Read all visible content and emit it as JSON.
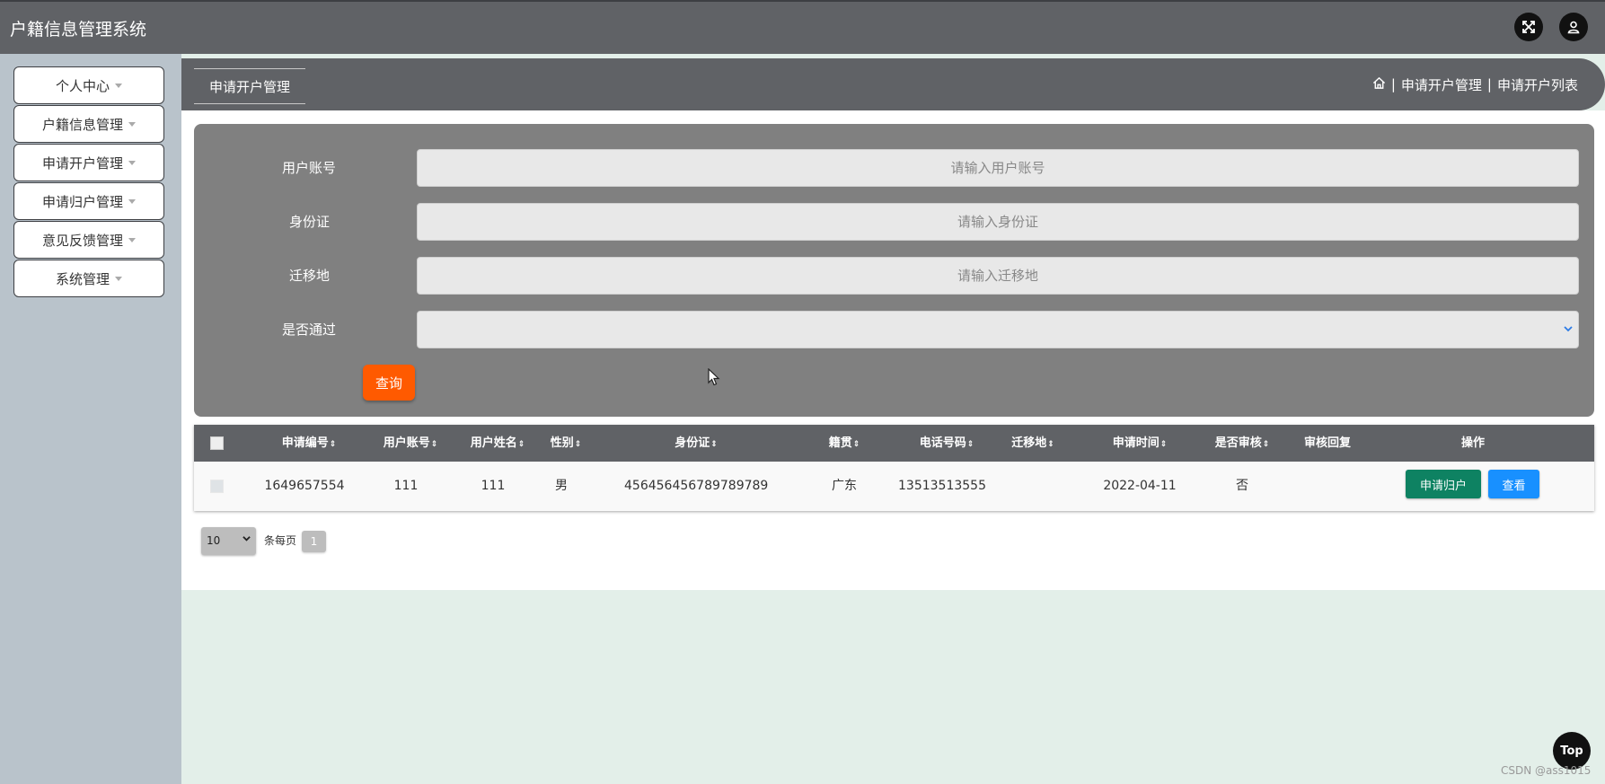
{
  "app": {
    "title": "户籍信息管理系统"
  },
  "header": {
    "fullscreen_icon": "expand-arrows-icon",
    "user_icon": "user-icon"
  },
  "sidebar": {
    "items": [
      {
        "label": "个人中心"
      },
      {
        "label": "户籍信息管理"
      },
      {
        "label": "申请开户管理"
      },
      {
        "label": "申请归户管理"
      },
      {
        "label": "意见反馈管理"
      },
      {
        "label": "系统管理"
      }
    ]
  },
  "breadcrumb": {
    "tab_label": "申请开户管理",
    "sep1": "|",
    "level1": "申请开户管理",
    "sep2": "|",
    "level2": "申请开户列表"
  },
  "search": {
    "fields": [
      {
        "label": "用户账号",
        "placeholder": "请输入用户账号",
        "value": ""
      },
      {
        "label": "身份证",
        "placeholder": "请输入身份证",
        "value": ""
      },
      {
        "label": "迁移地",
        "placeholder": "请输入迁移地",
        "value": ""
      }
    ],
    "select_label": "是否通过",
    "select_value": "",
    "query_button": "查询"
  },
  "table": {
    "columns": [
      {
        "label": "申请编号",
        "sortable": "⇕"
      },
      {
        "label": "用户账号",
        "sortable": "⇕"
      },
      {
        "label": "用户姓名",
        "sortable": "⇕"
      },
      {
        "label": "性别",
        "sortable": "⇕"
      },
      {
        "label": "身份证",
        "sortable": "⇕"
      },
      {
        "label": "籍贯",
        "sortable": "⇕"
      },
      {
        "label": "电话号码",
        "sortable": "⇕"
      },
      {
        "label": "迁移地",
        "sortable": "⇕"
      },
      {
        "label": "申请时间",
        "sortable": "⇕"
      },
      {
        "label": "是否审核",
        "sortable": "⇕"
      },
      {
        "label": "审核回复"
      },
      {
        "label": "操作"
      }
    ],
    "rows": [
      {
        "cells": [
          "1649657554",
          "111",
          "111",
          "男",
          "456456456789789789",
          "广东",
          "13513513555",
          "",
          "2022-04-11",
          "否",
          ""
        ],
        "action_primary": "申请归户",
        "action_secondary": "查看"
      }
    ]
  },
  "pagination": {
    "page_size": "10",
    "per_page_label": "条每页",
    "current_page": "1"
  },
  "back_to_top": "Top",
  "watermark": "CSDN @ass1015"
}
